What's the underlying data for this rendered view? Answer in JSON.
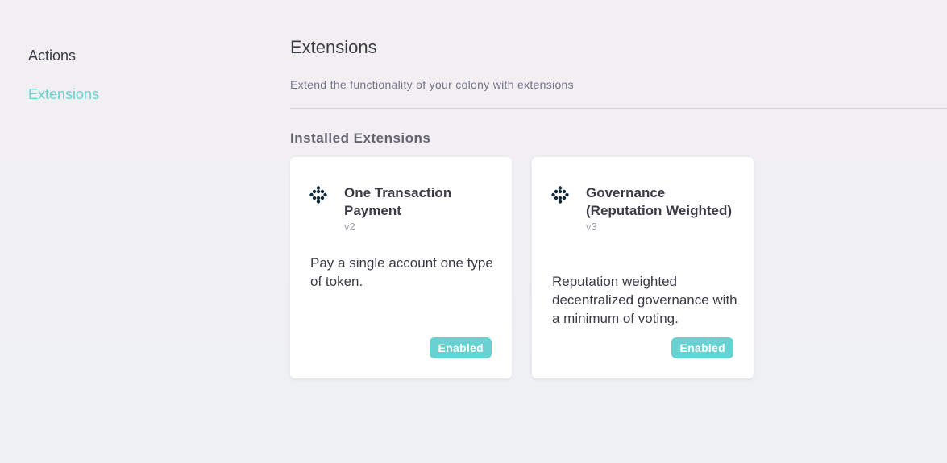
{
  "sidebar": {
    "items": [
      {
        "label": "Actions",
        "active": false
      },
      {
        "label": "Extensions",
        "active": true
      }
    ]
  },
  "main": {
    "title": "Extensions",
    "subtitle": "Extend the functionality of your colony with extensions",
    "section_title": "Installed Extensions",
    "extensions": [
      {
        "icon": "extension-dots-icon",
        "name": "One Transaction Payment",
        "version": "v2",
        "description": "Pay a single account one type of token.",
        "status": "Enabled"
      },
      {
        "icon": "extension-dots-icon",
        "name": "Governance (Reputation Weighted)",
        "version": "v3",
        "description": "Reputation weighted decentralized governance with a minimum of voting.",
        "status": "Enabled"
      }
    ]
  },
  "colors": {
    "accent": "#68d2d2",
    "text": "#3b3b46",
    "muted": "#76748b",
    "icon": "#0e2a3a"
  }
}
